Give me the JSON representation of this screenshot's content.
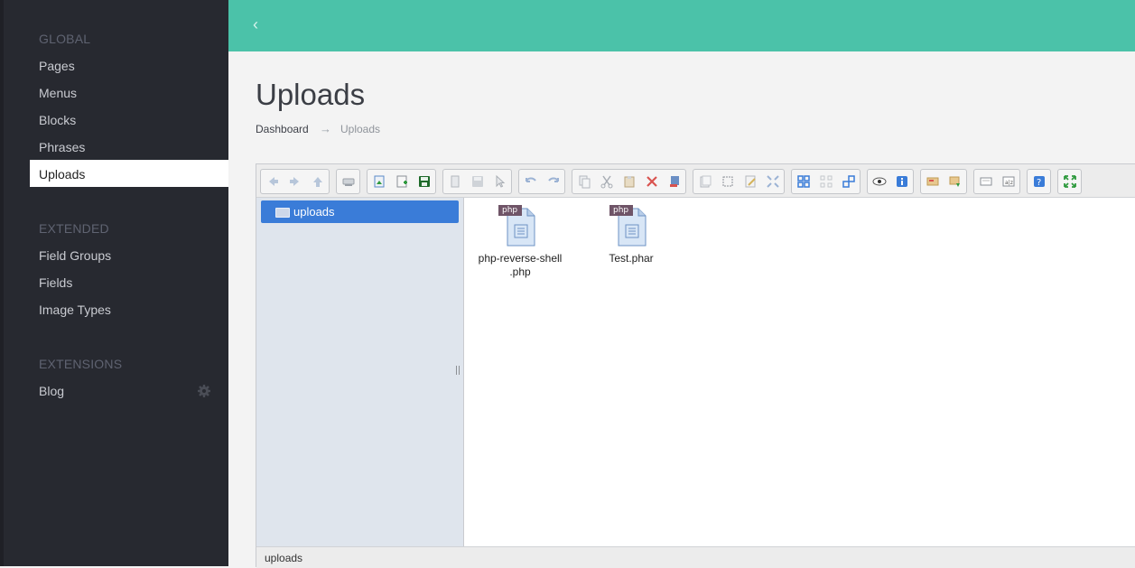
{
  "sidebar": {
    "sections": [
      {
        "title": "GLOBAL",
        "items": [
          "Pages",
          "Menus",
          "Blocks",
          "Phrases",
          "Uploads"
        ]
      },
      {
        "title": "EXTENDED",
        "items": [
          "Field Groups",
          "Fields",
          "Image Types"
        ]
      },
      {
        "title": "EXTENSIONS",
        "items": [
          "Blog"
        ]
      }
    ],
    "active_item": "Uploads",
    "gear_icon": "gear-icon"
  },
  "topbar": {
    "accent": "#4bc2a9",
    "back_icon": "chevron-left-icon"
  },
  "page": {
    "title": "Uploads"
  },
  "breadcrumb": {
    "items": [
      "Dashboard",
      "Uploads"
    ],
    "separator": "→"
  },
  "file_manager": {
    "toolbar_groups": [
      [
        "back-icon",
        "forward-icon",
        "up-icon"
      ],
      [
        "home-icon"
      ],
      [
        "upload-icon",
        "new-file-icon",
        "save-icon"
      ],
      [
        "open-icon",
        "save-disabled-icon",
        "select-icon"
      ],
      [
        "undo-icon",
        "redo-icon"
      ],
      [
        "copy-icon",
        "cut-icon",
        "paste-icon",
        "delete-icon",
        "empty-icon"
      ],
      [
        "duplicate-icon",
        "select-all-icon",
        "rename-icon",
        "resize-icon"
      ],
      [
        "icons-view-icon",
        "list-view-icon",
        "view-icon"
      ],
      [
        "preview-icon",
        "info-icon"
      ],
      [
        "extract-icon",
        "archive-icon"
      ],
      [
        "sort-icon",
        "search-icon"
      ],
      [
        "help-icon"
      ],
      [
        "fullscreen-icon"
      ]
    ],
    "tree": {
      "root_label": "uploads"
    },
    "files": [
      {
        "name": "php-reverse-shell\n.php",
        "badge": "php"
      },
      {
        "name": "Test.phar",
        "badge": "php"
      }
    ],
    "status_path": "uploads"
  }
}
